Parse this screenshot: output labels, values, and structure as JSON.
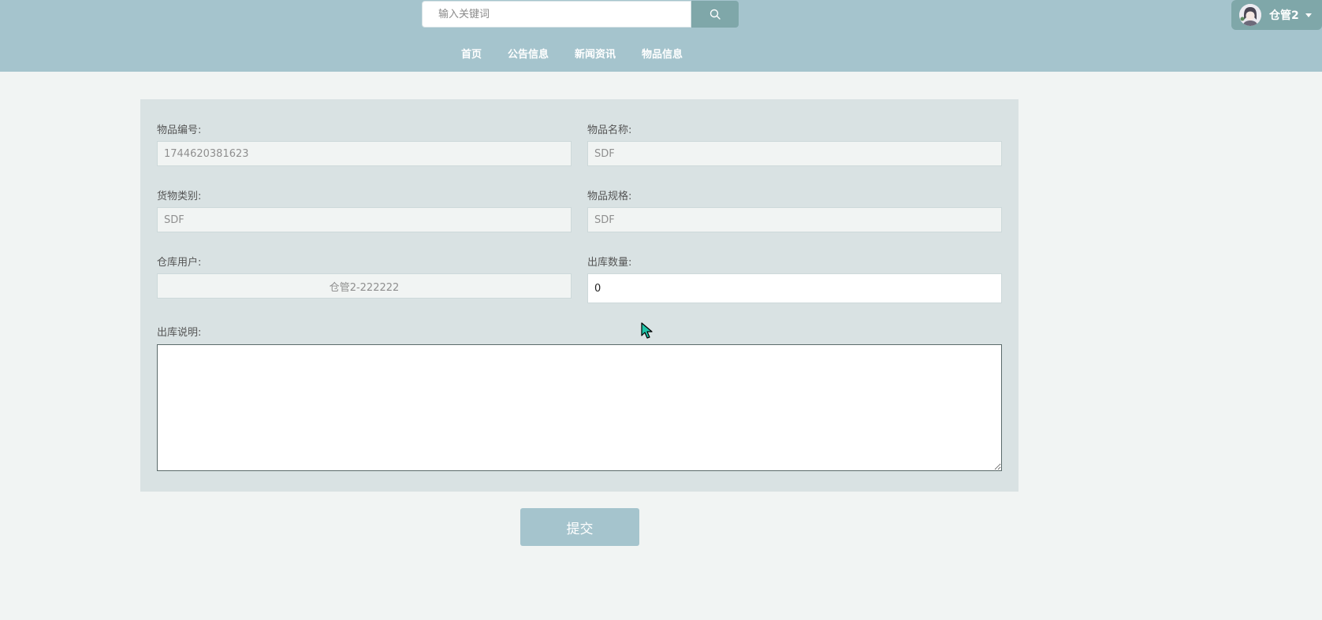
{
  "header": {
    "search_placeholder": "输入关键词",
    "nav": [
      "首页",
      "公告信息",
      "新闻资讯",
      "物品信息"
    ],
    "user_name": "仓管2"
  },
  "form": {
    "item_no_label": "物品编号:",
    "item_no_value": "1744620381623",
    "item_name_label": "物品名称:",
    "item_name_value": "SDF",
    "category_label": "货物类别:",
    "category_value": "SDF",
    "spec_label": "物品规格:",
    "spec_value": "SDF",
    "warehouse_user_label": "仓库用户:",
    "warehouse_user_value": "仓管2-222222",
    "out_qty_label": "出库数量:",
    "out_qty_value": "0",
    "out_desc_label": "出库说明:",
    "out_desc_value": ""
  },
  "submit_label": "提交",
  "colors": {
    "header_bg": "#a5c4cd",
    "accent": "#7fa7a9",
    "panel_bg": "#d9e2e3",
    "page_bg": "#f1f4f3"
  }
}
